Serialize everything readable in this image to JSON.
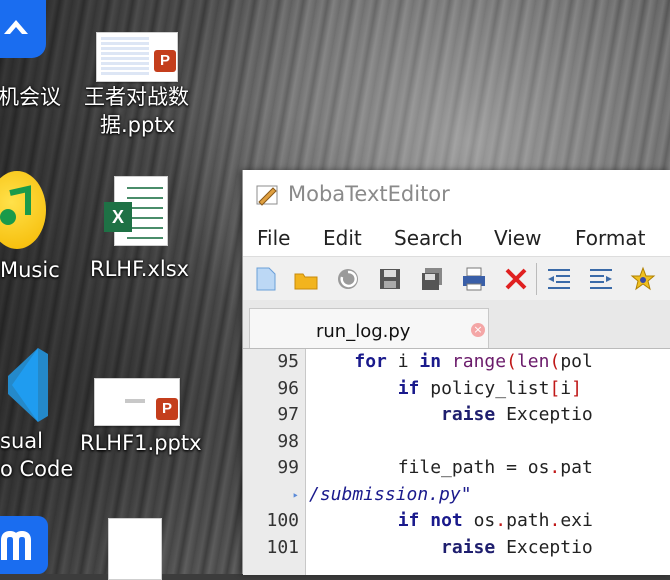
{
  "desktop": {
    "icons": [
      {
        "id": "meeting",
        "label": "机会议"
      },
      {
        "id": "pptx1",
        "label_line1": "王者对战数",
        "label_line2": "据.pptx"
      },
      {
        "id": "music",
        "label": "Music"
      },
      {
        "id": "xlsx",
        "label": "RLHF.xlsx"
      },
      {
        "id": "vscode",
        "label_line1": "sual",
        "label_line2": "o Code"
      },
      {
        "id": "pptx2",
        "label": "RLHF1.pptx"
      }
    ],
    "badges": {
      "ppt": "P",
      "xls": "X"
    }
  },
  "editor": {
    "title": "MobaTextEditor",
    "menu": [
      "File",
      "Edit",
      "Search",
      "View",
      "Format"
    ],
    "tab": {
      "label": "run_log.py",
      "close": "×"
    },
    "toolbar_icons": [
      "new-file-icon",
      "open-folder-icon",
      "reload-icon",
      "save-icon",
      "save-all-icon",
      "print-icon",
      "close-file-icon",
      "unindent-icon",
      "indent-icon",
      "bookmark-star-icon"
    ],
    "lines": [
      {
        "num": "95",
        "tokens": [
          [
            "",
            "    "
          ],
          [
            "kw",
            "for"
          ],
          [
            "",
            " i "
          ],
          [
            "kw",
            "in"
          ],
          [
            "",
            " "
          ],
          [
            "fn",
            "range"
          ],
          [
            "op",
            "("
          ],
          [
            "fn",
            "len"
          ],
          [
            "op",
            "("
          ],
          [
            "",
            "pol"
          ]
        ]
      },
      {
        "num": "96",
        "tokens": [
          [
            "",
            "        "
          ],
          [
            "kw",
            "if"
          ],
          [
            "",
            " policy_list"
          ],
          [
            "op",
            "["
          ],
          [
            "",
            "i"
          ],
          [
            "op",
            "]"
          ]
        ]
      },
      {
        "num": "97",
        "tokens": [
          [
            "",
            "            "
          ],
          [
            "kw2",
            "raise"
          ],
          [
            "",
            " Exceptio"
          ]
        ]
      },
      {
        "num": "98",
        "tokens": []
      },
      {
        "num": "99",
        "tokens": [
          [
            "",
            "        file_path = os"
          ],
          [
            "op",
            "."
          ],
          [
            "",
            "pat"
          ]
        ]
      },
      {
        "num": "",
        "wrap": "‣",
        "tokens": [
          [
            "str",
            "/submission.py\""
          ]
        ]
      },
      {
        "num": "100",
        "tokens": [
          [
            "",
            "        "
          ],
          [
            "kw",
            "if"
          ],
          [
            "",
            " "
          ],
          [
            "kw",
            "not"
          ],
          [
            "",
            " os"
          ],
          [
            "op",
            "."
          ],
          [
            "",
            "path"
          ],
          [
            "op",
            "."
          ],
          [
            "",
            "exi"
          ]
        ]
      },
      {
        "num": "101",
        "tokens": [
          [
            "",
            "            "
          ],
          [
            "kw2",
            "raise"
          ],
          [
            "",
            " Exceptio"
          ]
        ]
      }
    ]
  }
}
